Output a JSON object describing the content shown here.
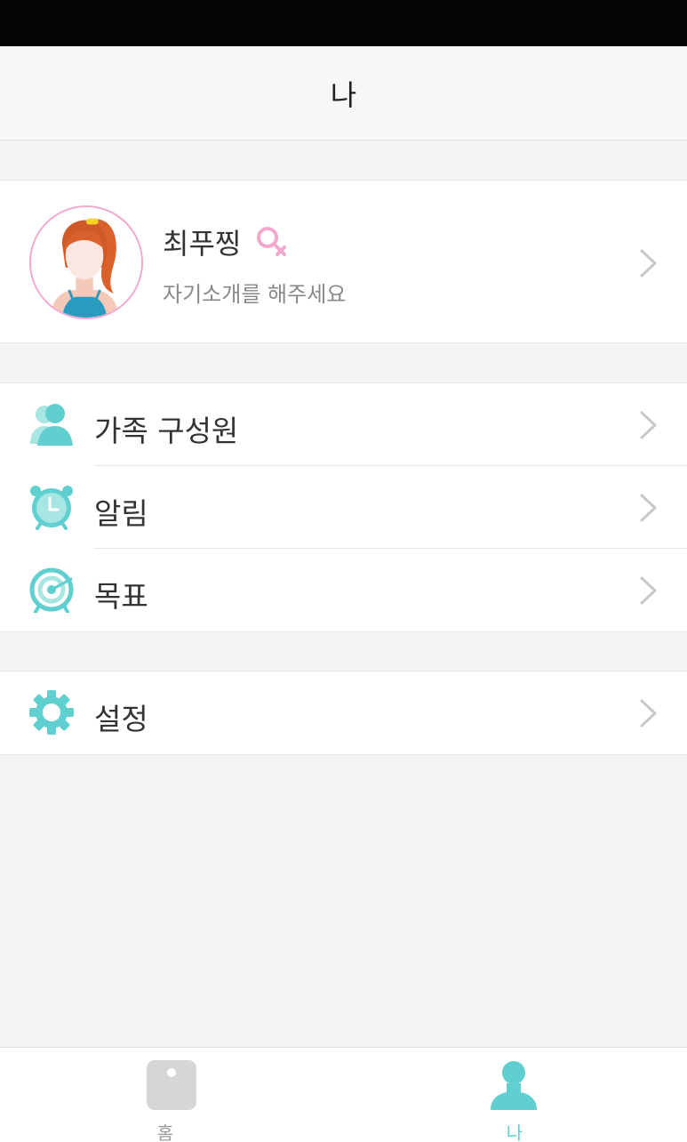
{
  "header": {
    "title": "나"
  },
  "profile": {
    "name": "최푸찡",
    "bio": "자기소개를 해주세요",
    "gender_icon": "female-icon",
    "accent_color": "#f2a7cf"
  },
  "menu": {
    "group1": [
      {
        "label": "가족 구성원",
        "icon": "family-icon"
      },
      {
        "label": "알림",
        "icon": "alarm-clock-icon"
      },
      {
        "label": "목표",
        "icon": "target-icon"
      }
    ],
    "group2": [
      {
        "label": "설정",
        "icon": "gear-icon"
      }
    ],
    "icon_color": "#5fcfcf"
  },
  "tabbar": {
    "tabs": [
      {
        "label": "홈",
        "icon": "scale-icon",
        "active": false
      },
      {
        "label": "나",
        "icon": "person-icon",
        "active": true
      }
    ],
    "active_color": "#5fcfcf",
    "inactive_color": "#9a9a9a"
  }
}
